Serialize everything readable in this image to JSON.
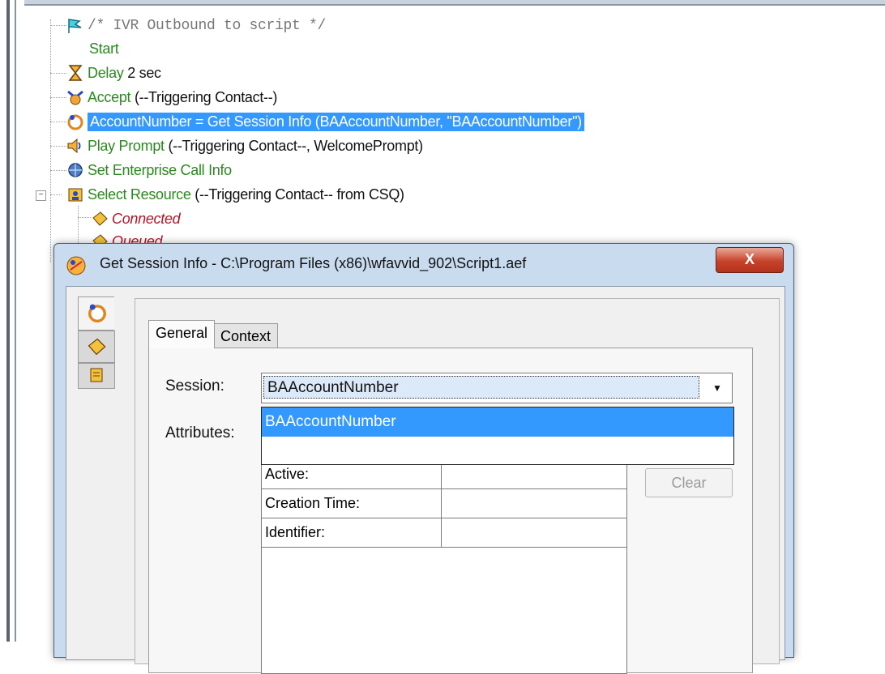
{
  "tree": {
    "comment": "/* IVR Outbound to script */",
    "start": "Start",
    "delay_kw": "Delay",
    "delay_args": "2 sec",
    "accept_kw": "Accept",
    "accept_args": "(--Triggering Contact--)",
    "selected_step": "AccountNumber = Get Session Info (BAAccountNumber, \"BAAccountNumber\")",
    "play_kw": "Play Prompt",
    "play_args": "(--Triggering Contact--, WelcomePrompt)",
    "enterprise_kw": "Set Enterprise Call Info",
    "select_kw": "Select Resource",
    "select_args": "(--Triggering Contact-- from CSQ)",
    "connected": "Connected",
    "queued": "Queued"
  },
  "dialog": {
    "title": "Get Session Info - C:\\Program Files (x86)\\wfavvid_902\\Script1.aef",
    "close_label": "X",
    "tabs": [
      "General",
      "Context"
    ],
    "session_label": "Session:",
    "session_value": "BAAccountNumber",
    "attributes_label": "Attributes:",
    "dropdown_options": [
      "BAAccountNumber"
    ],
    "attributes": [
      {
        "name": "Active:",
        "value": ""
      },
      {
        "name": "Creation Time:",
        "value": ""
      },
      {
        "name": "Identifier:",
        "value": ""
      }
    ],
    "clear_label": "Clear"
  },
  "colors": {
    "keyword": "#2b8a1f",
    "selection": "#3399ff",
    "italic_outcome": "#b0182b"
  }
}
